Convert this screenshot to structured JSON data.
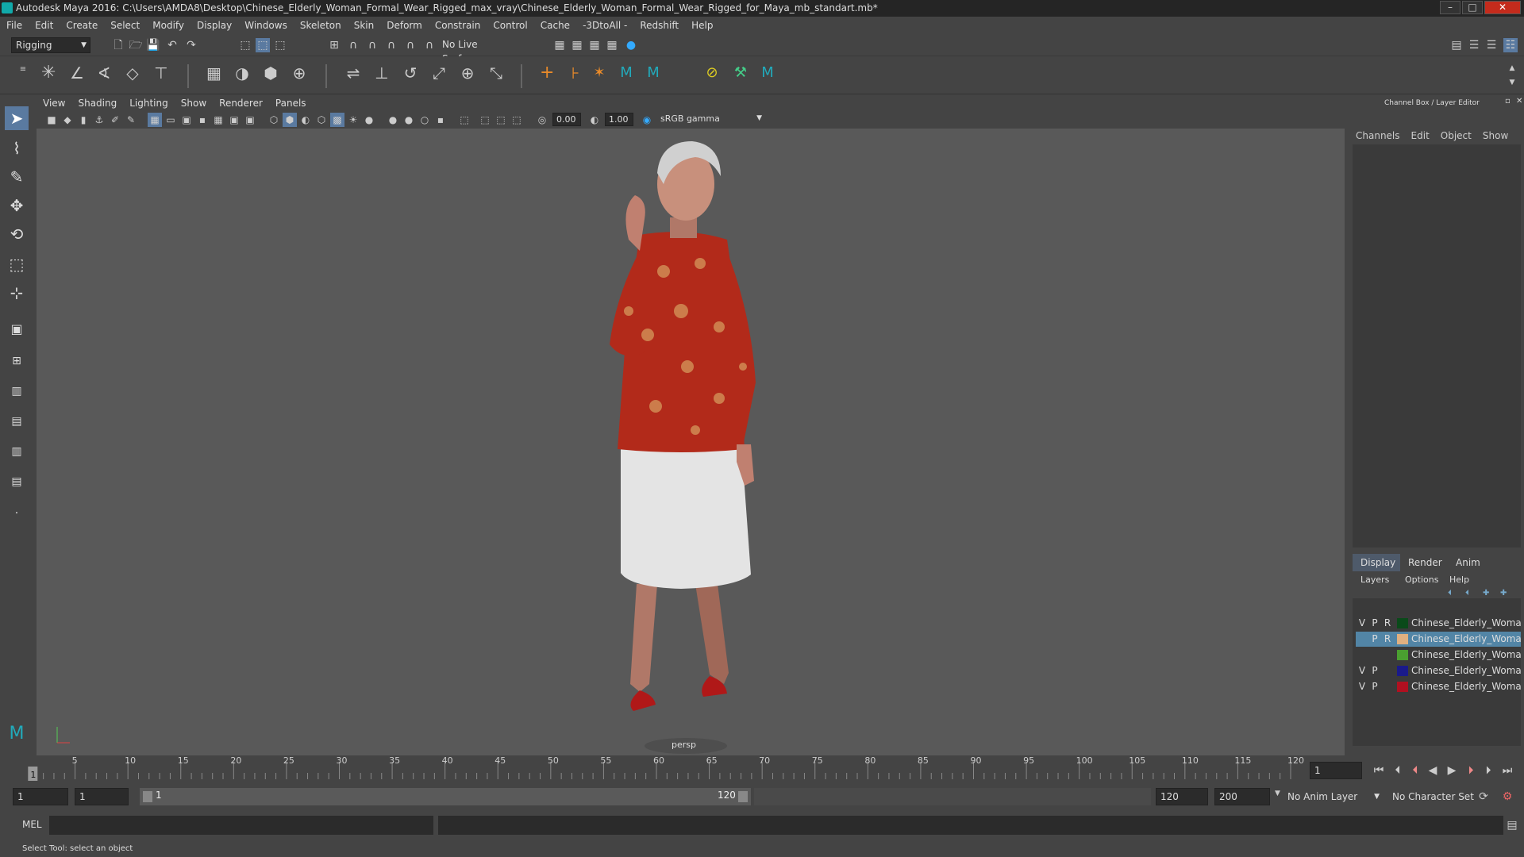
{
  "title": "Autodesk Maya 2016: C:\\Users\\AMDA8\\Desktop\\Chinese_Elderly_Woman_Formal_Wear_Rigged_max_vray\\Chinese_Elderly_Woman_Formal_Wear_Rigged_for_Maya_mb_standart.mb*",
  "menu": [
    "File",
    "Edit",
    "Create",
    "Select",
    "Modify",
    "Display",
    "Windows",
    "Skeleton",
    "Skin",
    "Deform",
    "Constrain",
    "Control",
    "Cache",
    "-3DtoAll -",
    "Redshift",
    "Help"
  ],
  "mode_menu": "Rigging",
  "live_surface": "No Live Surface",
  "viewport_menu": [
    "View",
    "Shading",
    "Lighting",
    "Show",
    "Renderer",
    "Panels"
  ],
  "vp_field1": "0.00",
  "vp_field2": "1.00",
  "color_space": "sRGB gamma",
  "camera_label": "persp",
  "channel_box_title": "Channel Box / Layer Editor",
  "channel_menu": [
    "Channels",
    "Edit",
    "Object",
    "Show"
  ],
  "layer_tabs": [
    "Display",
    "Render",
    "Anim"
  ],
  "layer_menu": [
    "Layers",
    "Options",
    "Help"
  ],
  "layers": [
    {
      "v": "V",
      "p": "P",
      "r": "R",
      "color": "#0a4a1a",
      "name": "Chinese_Elderly_Woma",
      "selected": false
    },
    {
      "v": "",
      "p": "P",
      "r": "R",
      "color": "#e0b080",
      "name": "Chinese_Elderly_Woman_For",
      "selected": true
    },
    {
      "v": "",
      "p": "",
      "r": "",
      "color": "#4aa030",
      "name": "Chinese_Elderly_Woman_For",
      "selected": false
    },
    {
      "v": "V",
      "p": "P",
      "r": "",
      "color": "#1a1a8a",
      "name": "Chinese_Elderly_Woman_Fc",
      "selected": false
    },
    {
      "v": "V",
      "p": "P",
      "r": "",
      "color": "#b01020",
      "name": "Chinese_Elderly_Woman_F",
      "selected": false
    }
  ],
  "timeline_ticks": [
    "5",
    "10",
    "15",
    "20",
    "25",
    "30",
    "35",
    "40",
    "45",
    "50",
    "55",
    "60",
    "65",
    "70",
    "75",
    "80",
    "85",
    "90",
    "95",
    "100",
    "105",
    "110",
    "115",
    "120"
  ],
  "current_frame_marker": "1",
  "current_frame": "1",
  "range_start": "1",
  "range_start_inner": "1",
  "range_slider_start": "1",
  "range_slider_end": "120",
  "range_end_inner": "120",
  "range_end": "200",
  "anim_layer": "No Anim Layer",
  "character_set": "No Character Set",
  "mel_label": "MEL",
  "help_text": "Select Tool: select an object",
  "icons": {
    "window_min": "–",
    "window_max": "□",
    "window_close": "✕"
  }
}
